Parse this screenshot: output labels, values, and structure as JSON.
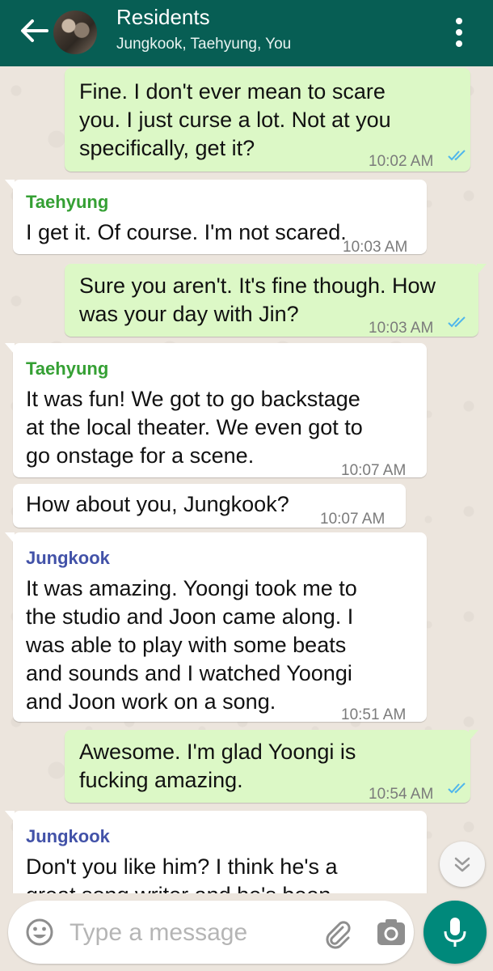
{
  "header": {
    "title": "Residents",
    "subtitle": "Jungkook, Taehyung, You"
  },
  "messages": [
    {
      "type": "out",
      "text": "Fine. I don't ever mean to scare you. I just curse a lot. Not at you specifically, get it?",
      "time": "10:02 AM",
      "read": true
    },
    {
      "type": "in",
      "sender": "Taehyung",
      "text": "I get it. Of course. I'm not scared.",
      "time": "10:03 AM"
    },
    {
      "type": "out",
      "text": "Sure you aren't. It's fine though. How was your day with Jin?",
      "time": "10:03 AM",
      "read": true
    },
    {
      "type": "in",
      "sender": "Taehyung",
      "text": "It was fun! We got to go backstage at the local theater. We even got to go onstage for a scene.",
      "time": "10:07 AM"
    },
    {
      "type": "in",
      "text": "How about you, Jungkook?",
      "time": "10:07 AM"
    },
    {
      "type": "in",
      "sender": "Jungkook",
      "text": "It was amazing. Yoongi took me to the studio and Joon came along. I was able to play with some beats and sounds and I watched Yoongi and Joon work on a song.",
      "time": "10:51 AM"
    },
    {
      "type": "out",
      "text": "Awesome. I'm glad Yoongi is fucking amazing.",
      "time": "10:54 AM",
      "read": true
    },
    {
      "type": "in",
      "sender": "Jungkook",
      "text": "Don't you like him? I think he's a great song writer and he's been"
    }
  ],
  "lines": {
    "m0": [
      "Fine. I don't ever mean to scare",
      "you. I just curse a lot. Not at you",
      "specifically, get it?"
    ],
    "m2": [
      "Sure you aren't. It's fine though. How",
      "was your day with Jin?"
    ],
    "m3": [
      "It was fun! We got to go backstage",
      "at the local theater. We even got to",
      "go onstage for a scene."
    ],
    "m5": [
      "It was amazing. Yoongi took me to",
      "the studio and Joon came along. I",
      "was able to play with some beats",
      "and sounds and I watched Yoongi",
      "and Joon work on a song."
    ],
    "m6": [
      "Awesome. I'm glad Yoongi is",
      "fucking amazing."
    ],
    "m7": [
      "Don't you like him? I think he's a",
      "great song writer and he's been"
    ]
  },
  "composer": {
    "placeholder": "Type a message"
  },
  "icons": {
    "back": "arrow-left-icon",
    "menu": "more-vert-icon",
    "emoji": "emoji-icon",
    "attach": "paperclip-icon",
    "camera": "camera-icon",
    "mic": "mic-icon",
    "scroll": "chevron-double-down-icon",
    "read": "double-check-icon"
  },
  "colors": {
    "header": "#075e54",
    "outgoing": "#dcf8c6",
    "incoming": "#ffffff",
    "taehyung": "#35a034",
    "jungkook": "#4252a8",
    "read_ticks": "#4fb6ec",
    "mic_button": "#00897b"
  }
}
